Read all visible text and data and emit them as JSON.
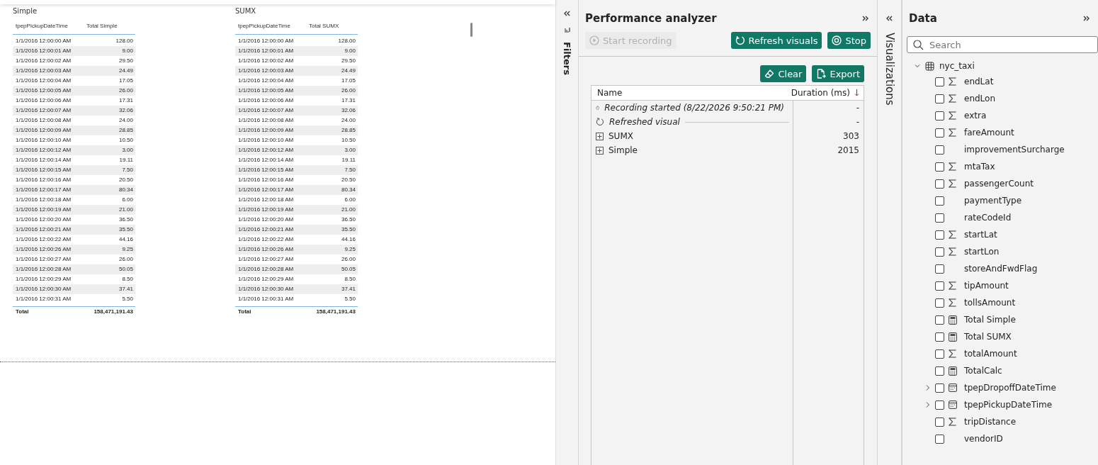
{
  "tables": [
    {
      "title": "Simple",
      "columns": [
        "tpepPickupDateTime",
        "Total Simple"
      ],
      "rows": [
        [
          "1/1/2016 12:00:00 AM",
          "128.00"
        ],
        [
          "1/1/2016 12:00:01 AM",
          "9.00"
        ],
        [
          "1/1/2016 12:00:02 AM",
          "29.50"
        ],
        [
          "1/1/2016 12:00:03 AM",
          "24.49"
        ],
        [
          "1/1/2016 12:00:04 AM",
          "17.05"
        ],
        [
          "1/1/2016 12:00:05 AM",
          "26.00"
        ],
        [
          "1/1/2016 12:00:06 AM",
          "17.31"
        ],
        [
          "1/1/2016 12:00:07 AM",
          "32.06"
        ],
        [
          "1/1/2016 12:00:08 AM",
          "24.00"
        ],
        [
          "1/1/2016 12:00:09 AM",
          "28.85"
        ],
        [
          "1/1/2016 12:00:10 AM",
          "10.50"
        ],
        [
          "1/1/2016 12:00:12 AM",
          "3.00"
        ],
        [
          "1/1/2016 12:00:14 AM",
          "19.11"
        ],
        [
          "1/1/2016 12:00:15 AM",
          "7.50"
        ],
        [
          "1/1/2016 12:00:16 AM",
          "20.50"
        ],
        [
          "1/1/2016 12:00:17 AM",
          "80.34"
        ],
        [
          "1/1/2016 12:00:18 AM",
          "6.00"
        ],
        [
          "1/1/2016 12:00:19 AM",
          "21.00"
        ],
        [
          "1/1/2016 12:00:20 AM",
          "36.50"
        ],
        [
          "1/1/2016 12:00:21 AM",
          "35.50"
        ],
        [
          "1/1/2016 12:00:22 AM",
          "44.16"
        ],
        [
          "1/1/2016 12:00:26 AM",
          "9.25"
        ],
        [
          "1/1/2016 12:00:27 AM",
          "26.00"
        ],
        [
          "1/1/2016 12:00:28 AM",
          "50.05"
        ],
        [
          "1/1/2016 12:00:29 AM",
          "8.50"
        ],
        [
          "1/1/2016 12:00:30 AM",
          "37.41"
        ],
        [
          "1/1/2016 12:00:31 AM",
          "5.50"
        ]
      ],
      "total": [
        "Total",
        "158,471,191.43"
      ]
    },
    {
      "title": "SUMX",
      "columns": [
        "tpepPickupDateTime",
        "Total SUMX"
      ],
      "rows": [
        [
          "1/1/2016 12:00:00 AM",
          "128.00"
        ],
        [
          "1/1/2016 12:00:01 AM",
          "9.00"
        ],
        [
          "1/1/2016 12:00:02 AM",
          "29.50"
        ],
        [
          "1/1/2016 12:00:03 AM",
          "24.49"
        ],
        [
          "1/1/2016 12:00:04 AM",
          "17.05"
        ],
        [
          "1/1/2016 12:00:05 AM",
          "26.00"
        ],
        [
          "1/1/2016 12:00:06 AM",
          "17.31"
        ],
        [
          "1/1/2016 12:00:07 AM",
          "32.06"
        ],
        [
          "1/1/2016 12:00:08 AM",
          "24.00"
        ],
        [
          "1/1/2016 12:00:09 AM",
          "28.85"
        ],
        [
          "1/1/2016 12:00:10 AM",
          "10.50"
        ],
        [
          "1/1/2016 12:00:12 AM",
          "3.00"
        ],
        [
          "1/1/2016 12:00:14 AM",
          "19.11"
        ],
        [
          "1/1/2016 12:00:15 AM",
          "7.50"
        ],
        [
          "1/1/2016 12:00:16 AM",
          "20.50"
        ],
        [
          "1/1/2016 12:00:17 AM",
          "80.34"
        ],
        [
          "1/1/2016 12:00:18 AM",
          "6.00"
        ],
        [
          "1/1/2016 12:00:19 AM",
          "21.00"
        ],
        [
          "1/1/2016 12:00:20 AM",
          "36.50"
        ],
        [
          "1/1/2016 12:00:21 AM",
          "35.50"
        ],
        [
          "1/1/2016 12:00:22 AM",
          "44.16"
        ],
        [
          "1/1/2016 12:00:26 AM",
          "9.25"
        ],
        [
          "1/1/2016 12:00:27 AM",
          "26.00"
        ],
        [
          "1/1/2016 12:00:28 AM",
          "50.05"
        ],
        [
          "1/1/2016 12:00:29 AM",
          "8.50"
        ],
        [
          "1/1/2016 12:00:30 AM",
          "37.41"
        ],
        [
          "1/1/2016 12:00:31 AM",
          "5.50"
        ]
      ],
      "total": [
        "Total",
        "158,471,191.43"
      ]
    }
  ],
  "filters": {
    "label": "Filters"
  },
  "performance_analyzer": {
    "title": "Performance analyzer",
    "buttons": [
      {
        "label": "Start recording",
        "kind": "play",
        "disabled": true
      },
      {
        "label": "Refresh visuals",
        "kind": "refresh",
        "disabled": false
      },
      {
        "label": "Stop",
        "kind": "stop",
        "disabled": false
      }
    ],
    "actions": [
      {
        "label": "Clear",
        "kind": "eraser"
      },
      {
        "label": "Export",
        "kind": "export"
      }
    ],
    "columns": [
      "Name",
      "Duration (ms)"
    ],
    "rows": [
      {
        "kind": "timer",
        "name": "Recording started (8/22/2026 9:50:21 PM)",
        "duration": "-"
      },
      {
        "kind": "refresh",
        "name": "Refreshed visual",
        "duration": "-"
      },
      {
        "kind": "visual",
        "name": "SUMX",
        "duration": "303",
        "expanded": false
      },
      {
        "kind": "visual",
        "name": "Simple",
        "duration": "2015",
        "expanded": false
      }
    ]
  },
  "visualizations": {
    "label": "Visualizations"
  },
  "data_pane": {
    "title": "Data",
    "search": {
      "placeholder": "Search"
    },
    "table": {
      "name": "nyc_taxi",
      "expanded": true,
      "children": [
        {
          "name": "endLat",
          "kind": "sum",
          "checked": false
        },
        {
          "name": "endLon",
          "kind": "sum",
          "checked": false
        },
        {
          "name": "extra",
          "kind": "sum",
          "checked": false
        },
        {
          "name": "fareAmount",
          "kind": "sum",
          "checked": false
        },
        {
          "name": "improvementSurcharge",
          "kind": "plain",
          "checked": false
        },
        {
          "name": "mtaTax",
          "kind": "sum",
          "checked": false
        },
        {
          "name": "passengerCount",
          "kind": "sum",
          "checked": false
        },
        {
          "name": "paymentType",
          "kind": "plain",
          "checked": false
        },
        {
          "name": "rateCodeId",
          "kind": "plain",
          "checked": false
        },
        {
          "name": "startLat",
          "kind": "sum",
          "checked": false
        },
        {
          "name": "startLon",
          "kind": "sum",
          "checked": false
        },
        {
          "name": "storeAndFwdFlag",
          "kind": "plain",
          "checked": false
        },
        {
          "name": "tipAmount",
          "kind": "sum",
          "checked": false
        },
        {
          "name": "tollsAmount",
          "kind": "sum",
          "checked": false
        },
        {
          "name": "Total Simple",
          "kind": "measure",
          "checked": false
        },
        {
          "name": "Total SUMX",
          "kind": "measure",
          "checked": false
        },
        {
          "name": "totalAmount",
          "kind": "sum",
          "checked": false
        },
        {
          "name": "TotalCalc",
          "kind": "measure",
          "checked": false
        },
        {
          "name": "tpepDropoffDateTime",
          "kind": "date",
          "checked": false,
          "expanded": false
        },
        {
          "name": "tpepPickupDateTime",
          "kind": "date",
          "checked": false,
          "expanded": false
        },
        {
          "name": "tripDistance",
          "kind": "sum",
          "checked": false
        },
        {
          "name": "vendorID",
          "kind": "plain",
          "checked": false
        }
      ]
    }
  }
}
